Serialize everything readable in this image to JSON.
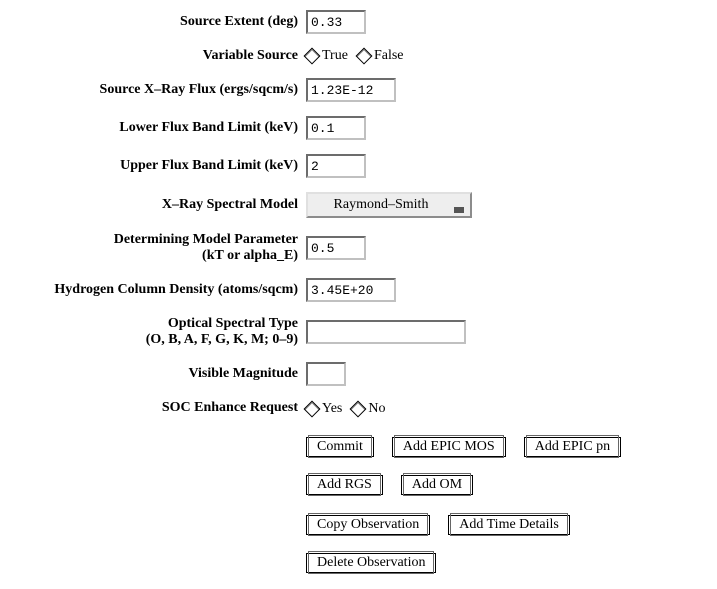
{
  "fields": {
    "source_extent": {
      "label": "Source Extent (deg)",
      "value": "0.33"
    },
    "variable_source": {
      "label": "Variable Source",
      "opt_true": "True",
      "opt_false": "False"
    },
    "xray_flux": {
      "label": "Source X–Ray Flux (ergs/sqcm/s)",
      "value": "1.23E-12"
    },
    "lower_flux": {
      "label": "Lower Flux Band Limit (keV)",
      "value": "0.1"
    },
    "upper_flux": {
      "label": "Upper Flux Band Limit (keV)",
      "value": "2"
    },
    "spectral_model": {
      "label": "X–Ray Spectral Model",
      "selected": "Raymond–Smith"
    },
    "model_param": {
      "label1": "Determining Model Parameter",
      "label2": "(kT or alpha_E)",
      "value": "0.5"
    },
    "hydrogen": {
      "label": "Hydrogen Column Density (atoms/sqcm)",
      "value": "3.45E+20"
    },
    "optical_type": {
      "label1": "Optical Spectral Type",
      "label2": "(O, B, A, F, G, K, M; 0–9)",
      "value": ""
    },
    "vis_mag": {
      "label": "Visible Magnitude",
      "value": ""
    },
    "soc_enhance": {
      "label": "SOC Enhance Request",
      "opt_yes": "Yes",
      "opt_no": "No"
    }
  },
  "buttons": {
    "commit": "Commit",
    "add_epic_mos": "Add EPIC MOS",
    "add_epic_pn": "Add EPIC pn",
    "add_rgs": "Add RGS",
    "add_om": "Add OM",
    "copy_obs": "Copy Observation",
    "add_time": "Add Time Details",
    "delete_obs": "Delete Observation"
  }
}
